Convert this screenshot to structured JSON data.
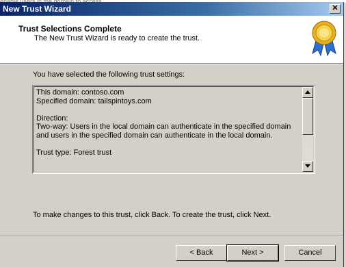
{
  "window": {
    "title": "New Trust Wizard",
    "close_glyph": "✕"
  },
  "background": {
    "partial_text": "enable users in the domain to access"
  },
  "header": {
    "title": "Trust Selections Complete",
    "subtitle": "The New Trust Wizard is ready to create the trust.",
    "icon": "certificate-seal-icon"
  },
  "body": {
    "intro": "You have selected the following trust settings:",
    "settings_lines": [
      "This domain: contoso.com",
      "Specified domain: tailspintoys.com",
      "",
      "Direction:",
      "Two-way: Users in the local domain can authenticate in the specified domain and users in the specified domain can authenticate in the local domain.",
      "",
      "Trust type: Forest trust"
    ],
    "footer_note": "To make changes to this trust, click Back. To create the trust, click Next."
  },
  "buttons": {
    "back": "< Back",
    "next": "Next >",
    "cancel": "Cancel"
  },
  "colors": {
    "title_bar_start": "#0a246a",
    "title_bar_end": "#a6caf0",
    "dialog_face": "#d4d0c8",
    "header_bg": "#ffffff"
  }
}
